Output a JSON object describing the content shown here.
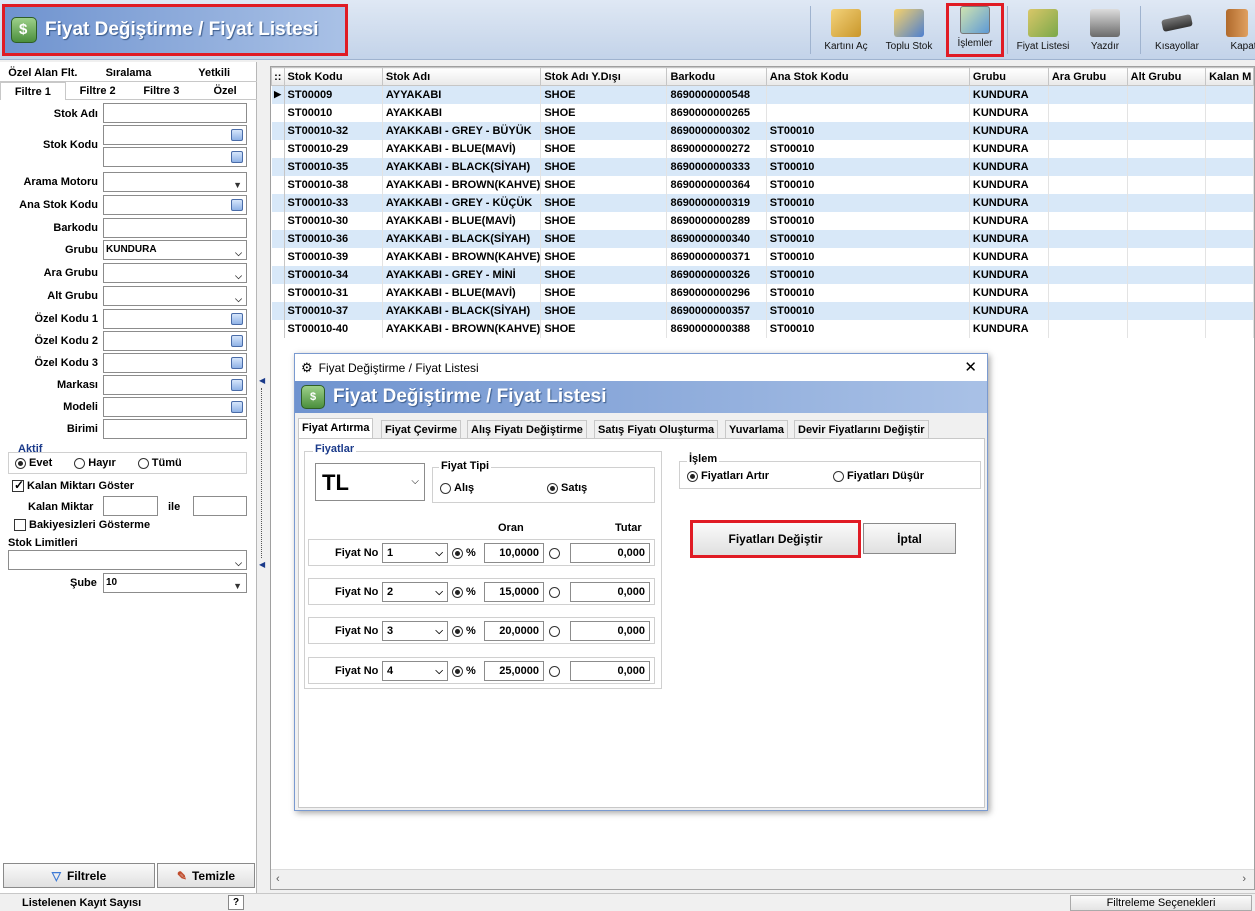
{
  "header": {
    "title": "Fiyat Değiştirme / Fiyat Listesi"
  },
  "toolbar": {
    "kartini_ac": "Kartını Aç",
    "toplu_stok": "Toplu Stok",
    "islemler": "İşlemler",
    "fiyat_listesi": "Fiyat Listesi",
    "yazdir": "Yazdır",
    "kisayollar": "Kısayollar",
    "kapat": "Kapat"
  },
  "left": {
    "tabs_top": [
      "Özel Alan Flt.",
      "Sıralama",
      "Yetkili"
    ],
    "tabs_bottom": [
      "Filtre 1",
      "Filtre 2",
      "Filtre 3",
      "Özel"
    ],
    "labels": {
      "stok_adi": "Stok Adı",
      "stok_kodu": "Stok Kodu",
      "arama_motoru": "Arama Motoru",
      "ana_stok_kodu": "Ana Stok Kodu",
      "barkodu": "Barkodu",
      "grubu": "Grubu",
      "ara_grubu": "Ara Grubu",
      "alt_grubu": "Alt Grubu",
      "ozel1": "Özel Kodu 1",
      "ozel2": "Özel Kodu 2",
      "ozel3": "Özel Kodu 3",
      "markasi": "Markası",
      "modeli": "Modeli",
      "birimi": "Birimi"
    },
    "grubu_value": "KUNDURA",
    "aktif": {
      "title": "Aktif",
      "evet": "Evet",
      "hayir": "Hayır",
      "tumu": "Tümü"
    },
    "kalan_goster": "Kalan Miktarı Göster",
    "kalan_miktar": "Kalan Miktar",
    "ile": "ile",
    "bakiyesizleri": "Bakiyesizleri Gösterme",
    "stok_limitleri": "Stok Limitleri",
    "sube": "Şube",
    "sube_value": "10",
    "filtrele": "Filtrele",
    "temizle": "Temizle"
  },
  "grid": {
    "columns": [
      "Stok Kodu",
      "Stok Adı",
      "Stok Adı Y.Dışı",
      "Barkodu",
      "Ana Stok Kodu",
      "Grubu",
      "Ara Grubu",
      "Alt Grubu",
      "Kalan M"
    ],
    "rows": [
      [
        "ST00009",
        "AYYAKABI",
        "SHOE",
        "8690000000548",
        "",
        "KUNDURA"
      ],
      [
        "ST00010",
        "AYAKKABI",
        "SHOE",
        "8690000000265",
        "",
        "KUNDURA"
      ],
      [
        "ST00010-32",
        "AYAKKABI - GREY - BÜYÜK",
        "SHOE",
        "8690000000302",
        "ST00010",
        "KUNDURA"
      ],
      [
        "ST00010-29",
        "AYAKKABI - BLUE(MAVİ)",
        "SHOE",
        "8690000000272",
        "ST00010",
        "KUNDURA"
      ],
      [
        "ST00010-35",
        "AYAKKABI - BLACK(SİYAH)",
        "SHOE",
        "8690000000333",
        "ST00010",
        "KUNDURA"
      ],
      [
        "ST00010-38",
        "AYAKKABI - BROWN(KAHVE)",
        "SHOE",
        "8690000000364",
        "ST00010",
        "KUNDURA"
      ],
      [
        "ST00010-33",
        "AYAKKABI - GREY - KÜÇÜK",
        "SHOE",
        "8690000000319",
        "ST00010",
        "KUNDURA"
      ],
      [
        "ST00010-30",
        "AYAKKABI - BLUE(MAVİ)",
        "SHOE",
        "8690000000289",
        "ST00010",
        "KUNDURA"
      ],
      [
        "ST00010-36",
        "AYAKKABI - BLACK(SİYAH)",
        "SHOE",
        "8690000000340",
        "ST00010",
        "KUNDURA"
      ],
      [
        "ST00010-39",
        "AYAKKABI - BROWN(KAHVE)",
        "SHOE",
        "8690000000371",
        "ST00010",
        "KUNDURA"
      ],
      [
        "ST00010-34",
        "AYAKKABI - GREY - MİNİ",
        "SHOE",
        "8690000000326",
        "ST00010",
        "KUNDURA"
      ],
      [
        "ST00010-31",
        "AYAKKABI - BLUE(MAVİ)",
        "SHOE",
        "8690000000296",
        "ST00010",
        "KUNDURA"
      ],
      [
        "ST00010-37",
        "AYAKKABI - BLACK(SİYAH)",
        "SHOE",
        "8690000000357",
        "ST00010",
        "KUNDURA"
      ],
      [
        "ST00010-40",
        "AYAKKABI - BROWN(KAHVE)",
        "SHOE",
        "8690000000388",
        "ST00010",
        "KUNDURA"
      ]
    ]
  },
  "dialog": {
    "window_title": "Fiyat Değiştirme / Fiyat Listesi",
    "banner_title": "Fiyat Değiştirme / Fiyat Listesi",
    "tabs": [
      "Fiyat Artırma",
      "Fiyat Çevirme",
      "Alış Fiyatı Değiştirme",
      "Satış Fiyatı Oluşturma",
      "Yuvarlama",
      "Devir Fiyatlarını Değiştir"
    ],
    "fiyatlar": "Fiyatlar",
    "currency": "TL",
    "fiyat_tipi": "Fiyat Tipi",
    "alis": "Alış",
    "satis": "Satış",
    "oran": "Oran",
    "tutar": "Tutar",
    "fiyat_no_label": "Fiyat No",
    "percent": "%",
    "rows": [
      {
        "no": "1",
        "oran": "10,0000",
        "tutar": "0,000"
      },
      {
        "no": "2",
        "oran": "15,0000",
        "tutar": "0,000"
      },
      {
        "no": "3",
        "oran": "20,0000",
        "tutar": "0,000"
      },
      {
        "no": "4",
        "oran": "25,0000",
        "tutar": "0,000"
      }
    ],
    "islem": "İşlem",
    "artir": "Fiyatları Artır",
    "dusur": "Fiyatları Düşür",
    "degistir": "Fiyatları Değiştir",
    "iptal": "İptal"
  },
  "status": {
    "kayit": "Listelenen Kayıt Sayısı",
    "help": "?",
    "filtreleme": "Filtreleme Seçenekleri"
  }
}
